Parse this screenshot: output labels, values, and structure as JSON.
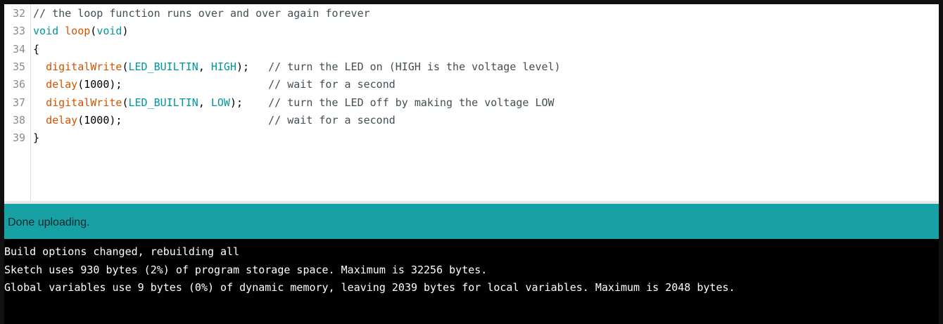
{
  "editor": {
    "lines": [
      {
        "num": "32",
        "segments": [
          {
            "cls": "cmt",
            "text": "// the loop function runs over and over again forever"
          }
        ]
      },
      {
        "num": "33",
        "segments": [
          {
            "cls": "kw",
            "text": "void"
          },
          {
            "cls": "plain",
            "text": " "
          },
          {
            "cls": "fn",
            "text": "loop"
          },
          {
            "cls": "plain",
            "text": "("
          },
          {
            "cls": "kw",
            "text": "void"
          },
          {
            "cls": "plain",
            "text": ")"
          }
        ]
      },
      {
        "num": "34",
        "segments": [
          {
            "cls": "plain",
            "text": "{"
          }
        ]
      },
      {
        "num": "35",
        "segments": [
          {
            "cls": "plain",
            "text": "  "
          },
          {
            "cls": "fn",
            "text": "digitalWrite"
          },
          {
            "cls": "plain",
            "text": "("
          },
          {
            "cls": "kw",
            "text": "LED_BUILTIN"
          },
          {
            "cls": "plain",
            "text": ", "
          },
          {
            "cls": "kw",
            "text": "HIGH"
          },
          {
            "cls": "plain",
            "text": ");   "
          },
          {
            "cls": "cmt",
            "text": "// turn the LED on (HIGH is the voltage level)"
          }
        ]
      },
      {
        "num": "36",
        "segments": [
          {
            "cls": "plain",
            "text": "  "
          },
          {
            "cls": "fn",
            "text": "delay"
          },
          {
            "cls": "plain",
            "text": "(1000);                       "
          },
          {
            "cls": "cmt",
            "text": "// wait for a second"
          }
        ]
      },
      {
        "num": "37",
        "segments": [
          {
            "cls": "plain",
            "text": "  "
          },
          {
            "cls": "fn",
            "text": "digitalWrite"
          },
          {
            "cls": "plain",
            "text": "("
          },
          {
            "cls": "kw",
            "text": "LED_BUILTIN"
          },
          {
            "cls": "plain",
            "text": ", "
          },
          {
            "cls": "kw",
            "text": "LOW"
          },
          {
            "cls": "plain",
            "text": ");    "
          },
          {
            "cls": "cmt",
            "text": "// turn the LED off by making the voltage LOW"
          }
        ]
      },
      {
        "num": "38",
        "segments": [
          {
            "cls": "plain",
            "text": "  "
          },
          {
            "cls": "fn",
            "text": "delay"
          },
          {
            "cls": "plain",
            "text": "(1000);                       "
          },
          {
            "cls": "cmt",
            "text": "// wait for a second"
          }
        ]
      },
      {
        "num": "39",
        "segments": [
          {
            "cls": "plain",
            "text": "}"
          }
        ]
      }
    ]
  },
  "status": {
    "message": "Done uploading."
  },
  "console": {
    "lines": [
      "Build options changed, rebuilding all",
      "Sketch uses 930 bytes (2%) of program storage space. Maximum is 32256 bytes.",
      "Global variables use 9 bytes (0%) of dynamic memory, leaving 2039 bytes for local variables. Maximum is 2048 bytes."
    ]
  },
  "colors": {
    "status_bar": "#17a1a5",
    "keyword": "#00979c",
    "function": "#d35400",
    "comment": "#434f54",
    "console_bg": "#000000"
  }
}
